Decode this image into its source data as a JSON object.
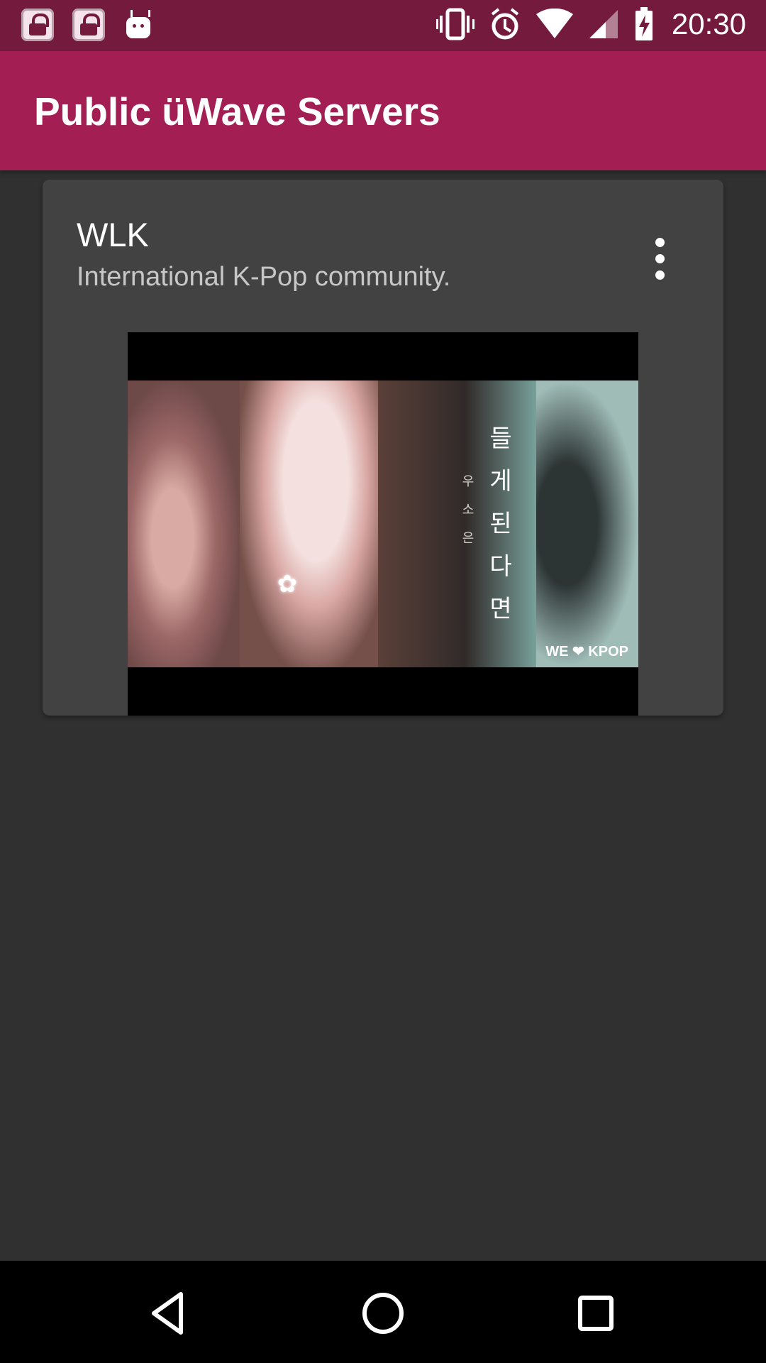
{
  "status_bar": {
    "time": "20:30",
    "icons": [
      "lock-icon",
      "lock-icon",
      "robot-icon",
      "vibrate-icon",
      "alarm-icon",
      "wifi-icon",
      "signal-icon",
      "battery-charging-icon"
    ]
  },
  "toolbar": {
    "title": "Public üWave Servers"
  },
  "server": {
    "name": "WLK",
    "description": "International K-Pop community.",
    "artwork": {
      "korean_title": "들게된다면",
      "korean_artist": "우소은",
      "caption": "WE ❤ KPOP"
    }
  },
  "navigation": {
    "icons": [
      "back-icon",
      "home-icon",
      "recents-icon"
    ]
  },
  "colors": {
    "status_bar": "#731a3d",
    "toolbar": "#a21e53",
    "background": "#303030",
    "card": "#424242"
  }
}
